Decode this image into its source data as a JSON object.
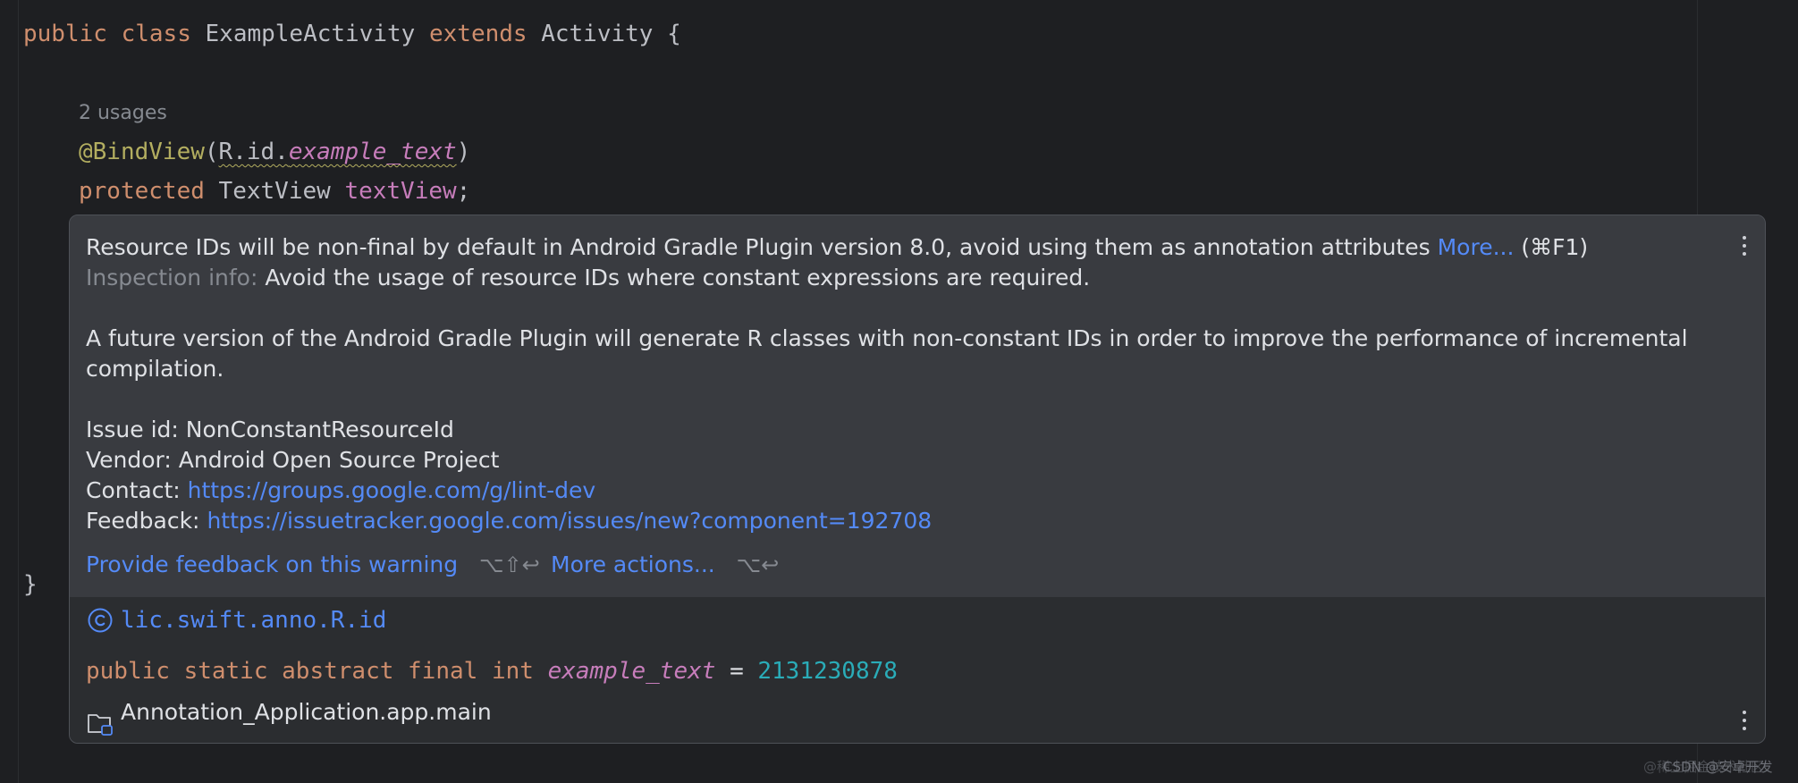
{
  "editor": {
    "line_class": {
      "kw1": "public",
      "kw2": "class",
      "name": "ExampleActivity",
      "kw3": "extends",
      "parent": "Activity",
      "brace": "{"
    },
    "usages": "2 usages",
    "line_annotation": {
      "annotation": "@BindView",
      "open": "(",
      "ref": "R.id.",
      "field": "example_text",
      "close": ")"
    },
    "line_field": {
      "kw": "protected",
      "type": "TextView",
      "name": "textView",
      "semi": ";"
    },
    "closing_brace": "}"
  },
  "popup": {
    "headline": "Resource IDs will be non-final by default in Android Gradle Plugin version 8.0, avoid using them as annotation attributes",
    "more_link": "More...",
    "more_shortcut": "(⌘F1)",
    "inspection_label": "Inspection info:",
    "inspection_text": "Avoid the usage of resource IDs where constant expressions are required.",
    "description_line1": "A future version of the Android Gradle Plugin will generate R classes with non-constant IDs in order to improve the performance of incremental",
    "description_line2": "compilation.",
    "issue_label": "Issue id:",
    "issue_value": "NonConstantResourceId",
    "vendor_label": "Vendor:",
    "vendor_value": "Android Open Source Project",
    "contact_label": "Contact:",
    "contact_url": "https://groups.google.com/g/lint-dev",
    "feedback_label": "Feedback:",
    "feedback_url": "https://issuetracker.google.com/issues/new?component=192708",
    "action_feedback": "Provide feedback on this warning",
    "action_feedback_shortcut": "⌥⇧↩",
    "action_more": "More actions...",
    "action_more_shortcut": "⌥↩",
    "doc": {
      "class_ref": "lic.swift.anno.R.id",
      "signature_kw": "public static abstract final int",
      "signature_field": "example_text",
      "signature_eq": "=",
      "signature_value": "2131230878",
      "module": "Annotation_Application.app.main"
    }
  },
  "watermark": {
    "under": "@稀土掘金技术社区",
    "over": "CSDN @安卓开发"
  },
  "colors": {
    "background": "#1e1f22",
    "popup": "#393b40",
    "popup_doc": "#2b2d30",
    "keyword": "#cf8e6d",
    "annotation": "#b3ae60",
    "field": "#c77dbb",
    "link": "#548af7",
    "number": "#2aacb8"
  },
  "icons": [
    "class-icon",
    "folder-icon",
    "more-options-icon"
  ]
}
